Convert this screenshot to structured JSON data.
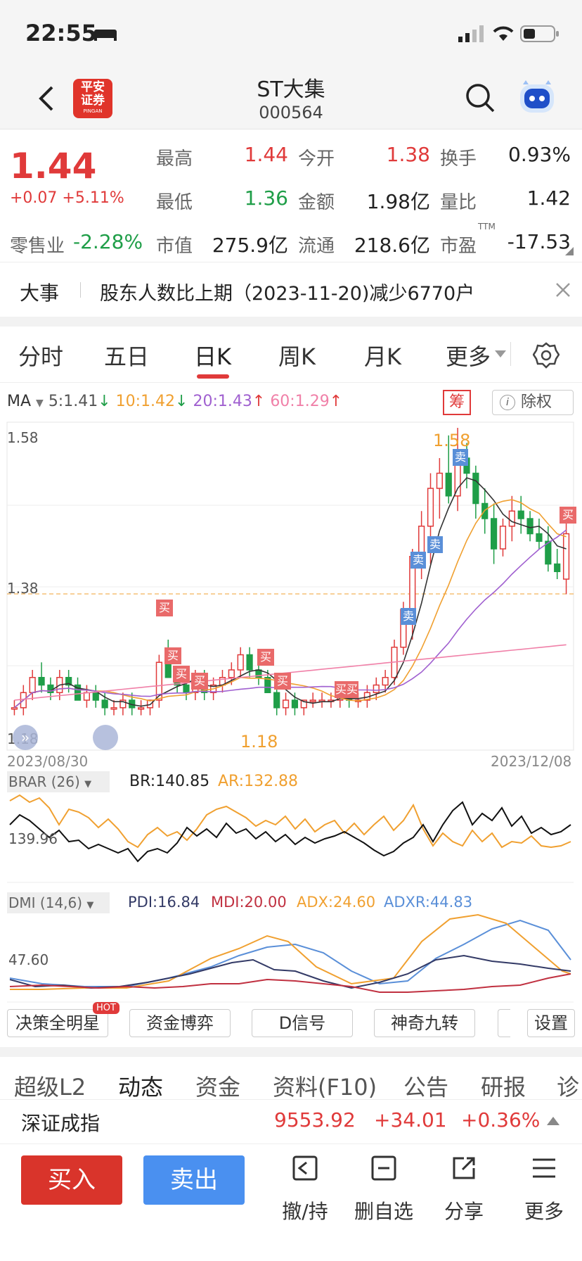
{
  "status": {
    "time": "22:55"
  },
  "nav": {
    "title": "ST大集",
    "code": "000564",
    "logo_line1": "平安",
    "logo_line2": "证券",
    "logo_sub": "PINGAN"
  },
  "quote": {
    "price": "1.44",
    "change": "+0.07",
    "change_pct": "+5.11%",
    "high_label": "最高",
    "high": "1.44",
    "open_label": "今开",
    "open": "1.38",
    "turnover_label": "换手",
    "turnover": "0.93%",
    "low_label": "最低",
    "low": "1.36",
    "amount_label": "金额",
    "amount": "1.98亿",
    "vol_ratio_label": "量比",
    "vol_ratio": "1.42",
    "sector": "零售业",
    "sector_pct": "-2.28%",
    "mcap_label": "市值",
    "mcap": "275.9亿",
    "float_label": "流通",
    "float": "218.6亿",
    "pe_label": "市盈",
    "pe_sup": "TTM",
    "pe": "-17.53"
  },
  "event": {
    "tag": "大事",
    "text": "股东人数比上期（2023-11-20)减少6770户"
  },
  "tabs": [
    "分时",
    "五日",
    "日K",
    "周K",
    "月K",
    "更多"
  ],
  "ma": {
    "label": "MA",
    "ma5": "5:1.41",
    "ma10": "10:1.42",
    "ma20": "20:1.43",
    "ma60": "60:1.29",
    "chip": "筹",
    "exright": "除权"
  },
  "kchart": {
    "y_top": "1.58",
    "y_mid": "1.38",
    "y_bot": "1.18",
    "peak": "1.58",
    "low_mark": "1.18",
    "date_start": "2023/08/30",
    "date_end": "2023/12/08",
    "buy": "买",
    "sell": "卖",
    "buy2": "买买"
  },
  "brar": {
    "label": "BRAR (26)",
    "br": "BR:140.85",
    "ar": "AR:132.88",
    "level": "139.96"
  },
  "dmi": {
    "label": "DMI (14,6)",
    "pdi": "PDI:16.84",
    "mdi": "MDI:20.00",
    "adx": "ADX:24.60",
    "adxr": "ADXR:44.83",
    "level": "47.60"
  },
  "tools": [
    "决策全明星",
    "资金博弈",
    "D信号",
    "神奇九转",
    "设置"
  ],
  "tools_hot": "HOT",
  "subtabs": [
    "超级L2",
    "动态",
    "资金",
    "资料(F10)",
    "公告",
    "研报",
    "诊"
  ],
  "index": {
    "name": "深证成指",
    "value": "9553.92",
    "change": "+34.01",
    "pct": "+0.36%"
  },
  "actions": {
    "buy": "买入",
    "sell": "卖出",
    "cancel": "撤/持",
    "remove": "删自选",
    "share": "分享",
    "more": "更多"
  },
  "colors": {
    "up": "#e03a3a",
    "down": "#1f9e48",
    "ma5": "#333333",
    "ma10": "#f0a030",
    "ma20": "#a060d0",
    "ma60": "#f080a8",
    "buy_btn": "#d9342b",
    "sell_btn": "#4a90f0"
  },
  "chart_data": {
    "type": "candlestick",
    "x_range": [
      "2023/08/30",
      "2023/12/08"
    ],
    "ylim": [
      1.18,
      1.58
    ],
    "ohlc": [
      [
        1.21,
        1.22,
        1.2,
        1.21
      ],
      [
        1.21,
        1.24,
        1.2,
        1.23
      ],
      [
        1.23,
        1.26,
        1.22,
        1.25
      ],
      [
        1.25,
        1.27,
        1.23,
        1.24
      ],
      [
        1.24,
        1.25,
        1.22,
        1.23
      ],
      [
        1.23,
        1.26,
        1.22,
        1.25
      ],
      [
        1.25,
        1.26,
        1.23,
        1.24
      ],
      [
        1.24,
        1.25,
        1.22,
        1.22
      ],
      [
        1.22,
        1.24,
        1.21,
        1.23
      ],
      [
        1.23,
        1.24,
        1.21,
        1.22
      ],
      [
        1.22,
        1.23,
        1.2,
        1.21
      ],
      [
        1.21,
        1.22,
        1.2,
        1.21
      ],
      [
        1.21,
        1.23,
        1.2,
        1.22
      ],
      [
        1.22,
        1.23,
        1.2,
        1.21
      ],
      [
        1.21,
        1.22,
        1.2,
        1.21
      ],
      [
        1.21,
        1.22,
        1.2,
        1.22
      ],
      [
        1.22,
        1.28,
        1.21,
        1.27
      ],
      [
        1.27,
        1.3,
        1.25,
        1.25
      ],
      [
        1.25,
        1.26,
        1.23,
        1.24
      ],
      [
        1.24,
        1.25,
        1.22,
        1.23
      ],
      [
        1.23,
        1.26,
        1.22,
        1.25
      ],
      [
        1.25,
        1.26,
        1.22,
        1.23
      ],
      [
        1.23,
        1.25,
        1.22,
        1.24
      ],
      [
        1.24,
        1.26,
        1.23,
        1.25
      ],
      [
        1.25,
        1.27,
        1.24,
        1.26
      ],
      [
        1.26,
        1.29,
        1.25,
        1.28
      ],
      [
        1.28,
        1.29,
        1.25,
        1.26
      ],
      [
        1.26,
        1.27,
        1.24,
        1.25
      ],
      [
        1.25,
        1.26,
        1.23,
        1.23
      ],
      [
        1.23,
        1.24,
        1.2,
        1.21
      ],
      [
        1.21,
        1.23,
        1.2,
        1.22
      ],
      [
        1.22,
        1.23,
        1.2,
        1.21
      ],
      [
        1.21,
        1.22,
        1.2,
        1.22
      ],
      [
        1.22,
        1.23,
        1.21,
        1.22
      ],
      [
        1.22,
        1.23,
        1.21,
        1.22
      ],
      [
        1.22,
        1.23,
        1.21,
        1.22
      ],
      [
        1.22,
        1.24,
        1.21,
        1.23
      ],
      [
        1.23,
        1.24,
        1.21,
        1.22
      ],
      [
        1.22,
        1.23,
        1.21,
        1.22
      ],
      [
        1.22,
        1.24,
        1.21,
        1.23
      ],
      [
        1.23,
        1.25,
        1.22,
        1.24
      ],
      [
        1.24,
        1.26,
        1.23,
        1.25
      ],
      [
        1.25,
        1.3,
        1.24,
        1.29
      ],
      [
        1.29,
        1.35,
        1.28,
        1.34
      ],
      [
        1.34,
        1.42,
        1.3,
        1.41
      ],
      [
        1.41,
        1.47,
        1.38,
        1.45
      ],
      [
        1.45,
        1.52,
        1.4,
        1.5
      ],
      [
        1.5,
        1.54,
        1.46,
        1.52
      ],
      [
        1.52,
        1.57,
        1.48,
        1.49
      ],
      [
        1.49,
        1.58,
        1.47,
        1.54
      ],
      [
        1.54,
        1.56,
        1.5,
        1.52
      ],
      [
        1.52,
        1.53,
        1.46,
        1.48
      ],
      [
        1.48,
        1.5,
        1.44,
        1.46
      ],
      [
        1.46,
        1.48,
        1.4,
        1.42
      ],
      [
        1.42,
        1.46,
        1.41,
        1.45
      ],
      [
        1.45,
        1.49,
        1.43,
        1.47
      ],
      [
        1.47,
        1.49,
        1.44,
        1.46
      ],
      [
        1.46,
        1.47,
        1.43,
        1.44
      ],
      [
        1.44,
        1.46,
        1.42,
        1.43
      ],
      [
        1.43,
        1.45,
        1.39,
        1.4
      ],
      [
        1.4,
        1.42,
        1.38,
        1.39
      ],
      [
        1.38,
        1.46,
        1.36,
        1.44
      ]
    ]
  }
}
